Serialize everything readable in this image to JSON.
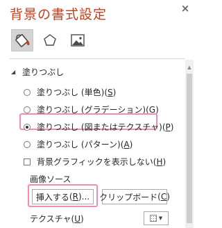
{
  "pane": {
    "title": "背景の書式設定",
    "close_glyph": "×"
  },
  "tabs": [
    {
      "name": "fill",
      "icon": "paint-bucket-icon",
      "active": true
    },
    {
      "name": "effects",
      "icon": "pentagon-icon",
      "active": false
    },
    {
      "name": "picture",
      "icon": "picture-icon",
      "active": false
    }
  ],
  "section": {
    "title": "塗りつぶし",
    "expanded": true
  },
  "fill_options": [
    {
      "label": "塗りつぶし (単色)",
      "key": "S",
      "checked": false
    },
    {
      "label": "塗りつぶし (グラデーション)",
      "key": "G",
      "checked": false
    },
    {
      "label": "塗りつぶし (図またはテクスチャ)",
      "key": "P",
      "checked": true
    },
    {
      "label": "塗りつぶし (パターン)",
      "key": "A",
      "checked": false
    }
  ],
  "hide_graphics": {
    "label": "背景グラフィックを表示しない",
    "key": "H",
    "checked": false
  },
  "image_source": {
    "label": "画像ソース",
    "insert_button": {
      "label": "挿入する",
      "key": "R",
      "suffix": "..."
    },
    "clipboard_button": {
      "label": "クリップボード",
      "key": "C"
    }
  },
  "texture": {
    "label": "テクスチャ",
    "key": "U"
  },
  "colors": {
    "title": "#c43e1c",
    "highlight": "#f28bb5",
    "active_tab": "#d4d4d4"
  }
}
